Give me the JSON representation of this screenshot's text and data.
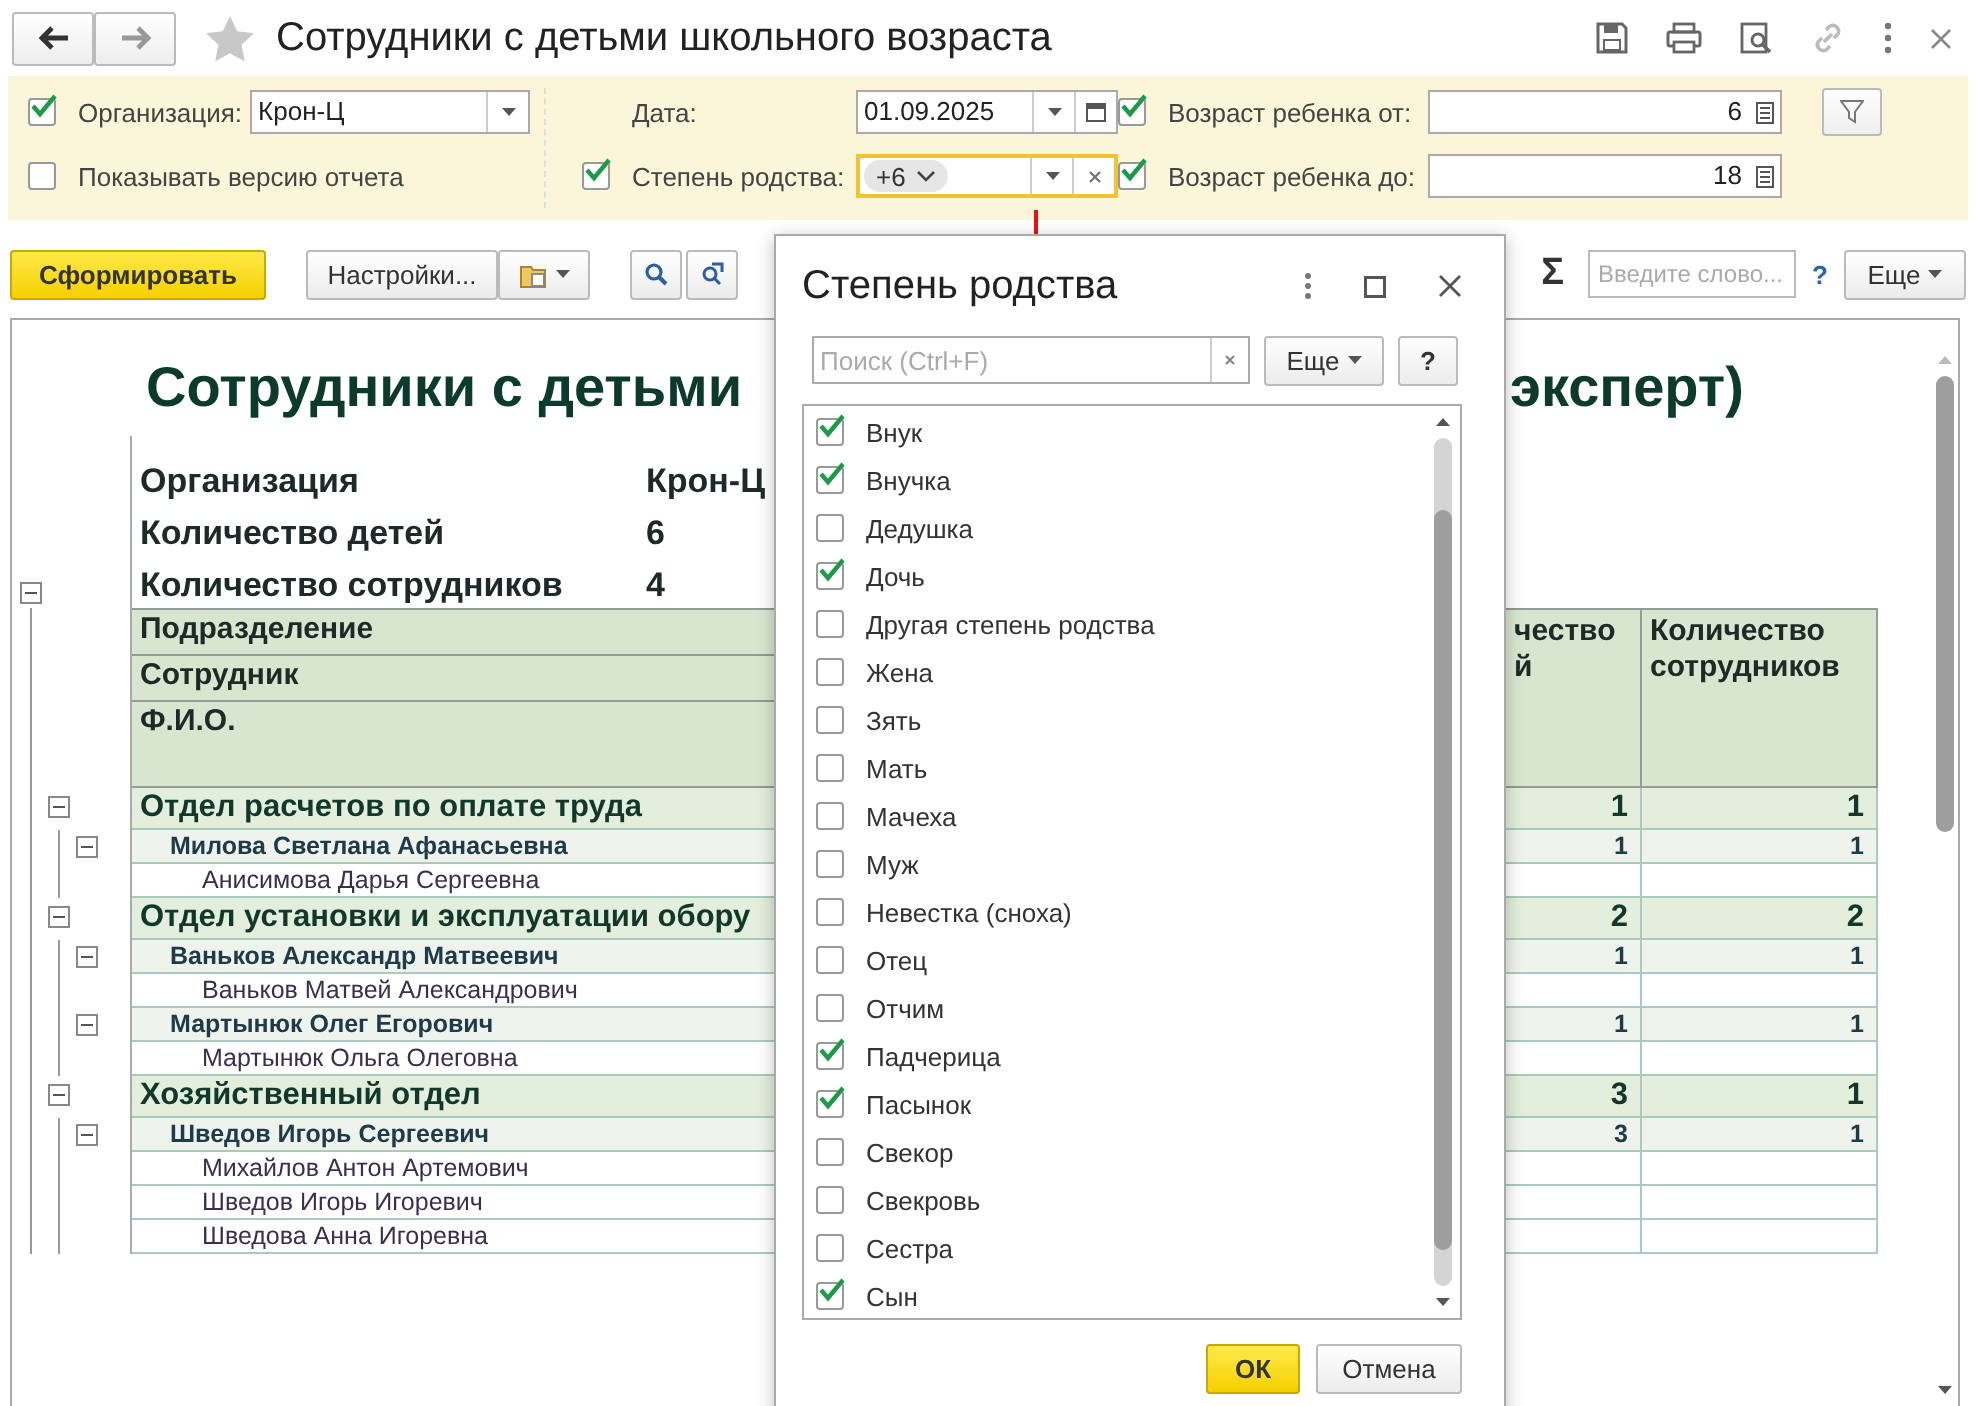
{
  "window": {
    "title": "Сотрудники с детьми школьного возраста"
  },
  "filters": {
    "organization": {
      "label": "Организация:",
      "value": "Крон-Ц",
      "checked": true
    },
    "show_version": {
      "label": "Показывать версию отчета",
      "checked": false
    },
    "date": {
      "label": "Дата:",
      "value": "01.09.2025"
    },
    "relation": {
      "label": "Степень родства:",
      "checked": true,
      "chip": "+6"
    },
    "age_from": {
      "label": "Возраст ребенка от:",
      "value": "6",
      "checked": true
    },
    "age_to": {
      "label": "Возраст ребенка до:",
      "value": "18",
      "checked": true
    }
  },
  "toolbar": {
    "generate": "Сформировать",
    "settings": "Настройки...",
    "sigma": "Σ",
    "search_placeholder": "Введите слово...",
    "help": "?",
    "more": "Еще"
  },
  "report": {
    "title": "Сотрудники с детьми",
    "title_tail": "эксперт)",
    "expanded": true,
    "summary": [
      {
        "label": "Организация",
        "value": "Крон-Ц"
      },
      {
        "label": "Количество детей",
        "value": "6"
      },
      {
        "label": "Количество сотрудников",
        "value": "4"
      }
    ],
    "header": {
      "rows": [
        "Подразделение",
        "Сотрудник",
        "Ф.И.О."
      ],
      "column_3": [
        "чество",
        "й"
      ],
      "column_4": "Количество сотрудников"
    },
    "groups": [
      {
        "name": "Отдел расчетов по оплате труда",
        "children_count": "1",
        "employees_count": "1",
        "expanded": true,
        "employees": [
          {
            "name": "Милова Светлана Афанасьевна",
            "children_count": "1",
            "employees_count": "1",
            "expanded": true,
            "children": [
              {
                "name": "Анисимова Дарья Сергеевна"
              }
            ]
          }
        ]
      },
      {
        "name": "Отдел установки и эксплуатации обору",
        "children_count": "2",
        "employees_count": "2",
        "expanded": true,
        "employees": [
          {
            "name": "Ваньков Александр Матвеевич",
            "children_count": "1",
            "employees_count": "1",
            "expanded": true,
            "children": [
              {
                "name": "Ваньков Матвей Александрович"
              }
            ]
          },
          {
            "name": "Мартынюк Олег Егорович",
            "children_count": "1",
            "employees_count": "1",
            "expanded": true,
            "children": [
              {
                "name": "Мартынюк Ольга Олеговна"
              }
            ]
          }
        ]
      },
      {
        "name": "Хозяйственный отдел",
        "children_count": "3",
        "employees_count": "1",
        "expanded": true,
        "employees": [
          {
            "name": "Шведов Игорь Сергеевич",
            "children_count": "3",
            "employees_count": "1",
            "expanded": true,
            "children": [
              {
                "name": "Михайлов Антон Артемович"
              },
              {
                "name": "Шведов Игорь Игоревич"
              },
              {
                "name": "Шведова Анна Игоревна"
              }
            ]
          }
        ]
      }
    ]
  },
  "dialog": {
    "title": "Степень родства",
    "search_placeholder": "Поиск (Ctrl+F)",
    "more": "Еще",
    "help": "?",
    "items": [
      {
        "label": "Внук",
        "checked": true
      },
      {
        "label": "Внучка",
        "checked": true
      },
      {
        "label": "Дедушка",
        "checked": false
      },
      {
        "label": "Дочь",
        "checked": true
      },
      {
        "label": "Другая степень родства",
        "checked": false
      },
      {
        "label": "Жена",
        "checked": false
      },
      {
        "label": "Зять",
        "checked": false
      },
      {
        "label": "Мать",
        "checked": false
      },
      {
        "label": "Мачеха",
        "checked": false
      },
      {
        "label": "Муж",
        "checked": false
      },
      {
        "label": "Невестка (сноха)",
        "checked": false
      },
      {
        "label": "Отец",
        "checked": false
      },
      {
        "label": "Отчим",
        "checked": false
      },
      {
        "label": "Падчерица",
        "checked": true
      },
      {
        "label": "Пасынок",
        "checked": true
      },
      {
        "label": "Свекор",
        "checked": false
      },
      {
        "label": "Свекровь",
        "checked": false
      },
      {
        "label": "Сестра",
        "checked": false
      },
      {
        "label": "Сын",
        "checked": true
      }
    ],
    "ok": "ОК",
    "cancel": "Отмена"
  }
}
